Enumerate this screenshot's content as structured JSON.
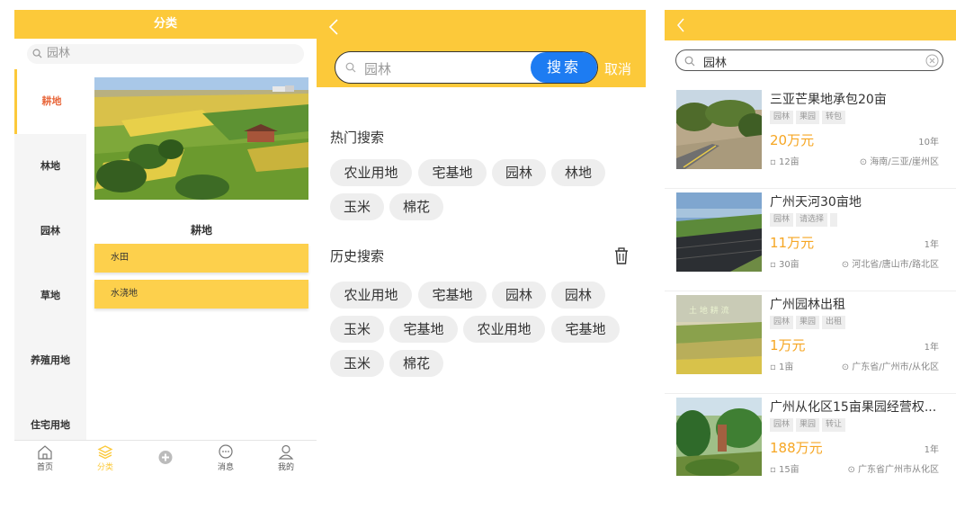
{
  "category_page": {
    "title": "分类",
    "search_placeholder": "园林",
    "sidebar": [
      "耕地",
      "林地",
      "园林",
      "草地",
      "养殖用地",
      "住宅用地"
    ],
    "active_index": 0,
    "banner_watermark": "银山林业部分图片",
    "subcategory_title": "耕地",
    "subcategories": [
      "水田",
      "水浇地"
    ],
    "tabbar": [
      {
        "label": "首页",
        "icon": "home-icon"
      },
      {
        "label": "分类",
        "icon": "category-icon"
      },
      {
        "label": "",
        "icon": "add-icon"
      },
      {
        "label": "消息",
        "icon": "message-icon"
      },
      {
        "label": "我的",
        "icon": "user-icon"
      }
    ],
    "accent": "#fcc93a",
    "active_text_color": "#e8663a"
  },
  "search_page": {
    "search_value": "园林",
    "search_button": "搜索",
    "cancel": "取消",
    "hot_title": "热门搜索",
    "hot_tags": [
      "农业用地",
      "宅基地",
      "园林",
      "林地",
      "玉米",
      "棉花"
    ],
    "history_title": "历史搜索",
    "history_tags": [
      "农业用地",
      "宅基地",
      "园林",
      "园林",
      "玉米",
      "宅基地",
      "农业用地",
      "宅基地",
      "玉米",
      "棉花"
    ],
    "button_color": "#1d7cf2"
  },
  "results_page": {
    "search_value": "园林",
    "price_color": "#f6a623",
    "items": [
      {
        "title": "三亚芒果地承包20亩",
        "tags": [
          "园林",
          "果园",
          "转包"
        ],
        "price": "20万元",
        "term": "10年",
        "area": "12亩",
        "location": "海南/三亚/崖州区"
      },
      {
        "title": "广州天河30亩地",
        "tags": [
          "园林",
          "请选择",
          ""
        ],
        "price": "11万元",
        "term": "1年",
        "area": "30亩",
        "location": "河北省/唐山市/路北区"
      },
      {
        "title": "广州园林出租",
        "tags": [
          "园林",
          "果园",
          "出租"
        ],
        "price": "1万元",
        "term": "1年",
        "area": "1亩",
        "location": "广东省/广州市/从化区"
      },
      {
        "title": "广州从化区15亩果园经营权...",
        "tags": [
          "园林",
          "果园",
          "转让"
        ],
        "price": "188万元",
        "term": "1年",
        "area": "15亩",
        "location": "广东省广州市从化区"
      }
    ]
  }
}
